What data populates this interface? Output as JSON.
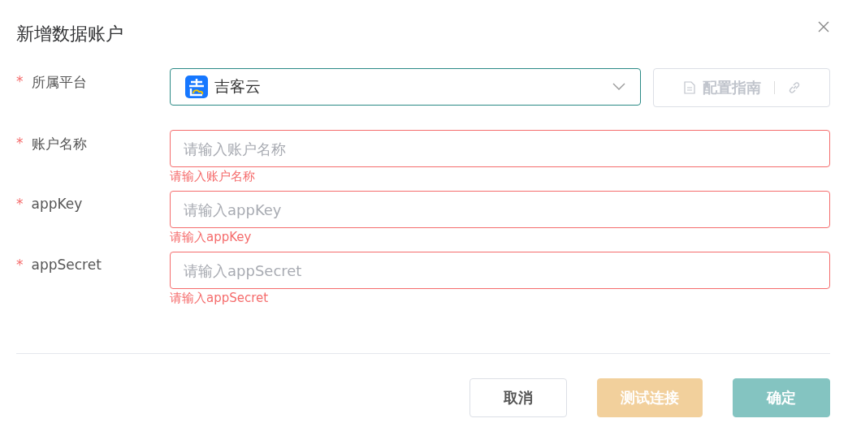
{
  "dialog": {
    "title": "新增数据账户"
  },
  "platform": {
    "label": "所属平台",
    "required_mark": "*",
    "value": "吉客云"
  },
  "guide": {
    "label": "配置指南",
    "disabled": true
  },
  "fields": [
    {
      "label": "账户名称",
      "required_mark": "*",
      "placeholder": "请输入账户名称",
      "error": "请输入账户名称"
    },
    {
      "label": "appKey",
      "required_mark": "*",
      "placeholder": "请输入appKey",
      "error": "请输入appKey"
    },
    {
      "label": "appSecret",
      "required_mark": "*",
      "placeholder": "请输入appSecret",
      "error": "请输入appSecret"
    }
  ],
  "buttons": [
    {
      "label": "取消",
      "kind": "default",
      "disabled": false
    },
    {
      "label": "测试连接",
      "kind": "warning",
      "disabled": true
    },
    {
      "label": "确定",
      "kind": "primary",
      "disabled": true
    }
  ]
}
